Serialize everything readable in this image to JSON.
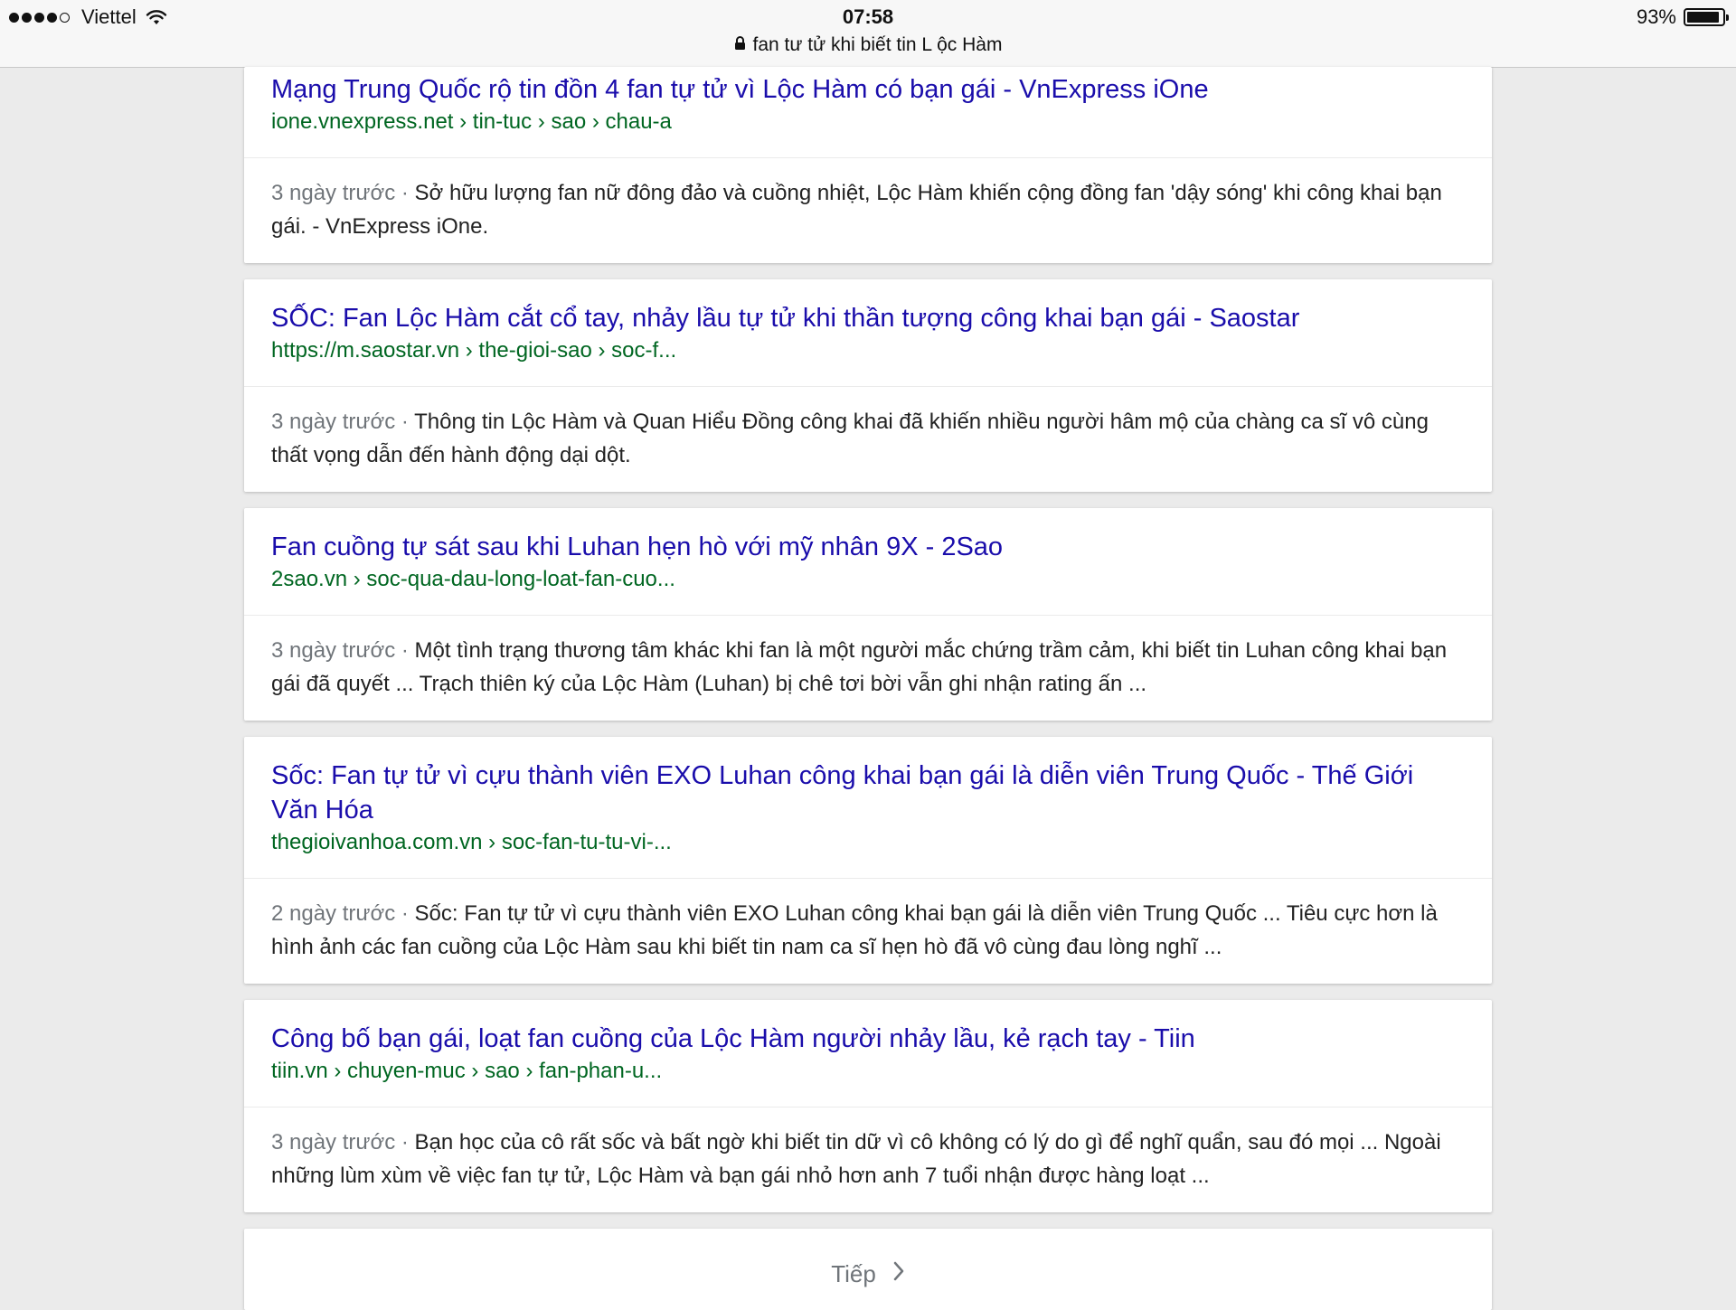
{
  "status_bar": {
    "carrier": "Viettel",
    "time": "07:58",
    "url": "fan tư tử khi biết tin L ộc Hàm",
    "battery": "93%",
    "battery_level": 0.93
  },
  "results": [
    {
      "title": "Mạng Trung Quốc rộ tin đồn 4 fan tự tử vì Lộc Hàm có bạn gái - VnExpress iOne",
      "url": "ione.vnexpress.net › tin-tuc › sao › chau-a",
      "date": "3 ngày trước",
      "snippet": "Sở hữu lượng fan nữ đông đảo và cuồng nhiệt, Lộc Hàm khiến cộng đồng fan 'dậy sóng' khi công khai bạn gái. - VnExpress iOne."
    },
    {
      "title": "SỐC: Fan Lộc Hàm cắt cổ tay, nhảy lầu tự tử khi thần tượng công khai bạn gái - Saostar",
      "url": "https://m.saostar.vn › the-gioi-sao › soc-f...",
      "date": "3 ngày trước",
      "snippet": "Thông tin Lộc Hàm và Quan Hiểu Đồng công khai đã khiến nhiều người hâm mộ của chàng ca sĩ vô cùng thất vọng dẫn đến hành động dại dột."
    },
    {
      "title": "Fan cuồng tự sát sau khi Luhan hẹn hò với mỹ nhân 9X - 2Sao",
      "url": "2sao.vn › soc-qua-dau-long-loat-fan-cuo...",
      "date": "3 ngày trước",
      "snippet": "Một tình trạng thương tâm khác khi fan là một người mắc chứng trầm cảm, khi biết tin Luhan công khai bạn gái đã quyết ... Trạch thiên ký của Lộc Hàm (Luhan) bị chê tơi bời vẫn ghi nhận rating ấn ..."
    },
    {
      "title": "Sốc: Fan tự tử vì cựu thành viên EXO Luhan công khai bạn gái là diễn viên Trung Quốc - Thế Giới Văn Hóa",
      "url": "thegioivanhoa.com.vn › soc-fan-tu-tu-vi-...",
      "date": "2 ngày trước",
      "snippet": "Sốc: Fan tự tử vì cựu thành viên EXO Luhan công khai bạn gái là diễn viên Trung Quốc ... Tiêu cực hơn là hình ảnh các fan cuồng của Lộc Hàm sau khi biết tin nam ca sĩ hẹn hò đã vô cùng đau lòng nghĩ ..."
    },
    {
      "title": "Công bố bạn gái, loạt fan cuồng của Lộc Hàm người nhảy lầu, kẻ rạch tay - Tiin",
      "url": "tiin.vn › chuyen-muc › sao › fan-phan-u...",
      "date": "3 ngày trước",
      "snippet": "Bạn học của cô rất sốc và bất ngờ khi biết tin dữ vì cô không có lý do gì để nghĩ quẩn, sau đó mọi ... Ngoài những lùm xùm về việc fan tự tử, Lộc Hàm và bạn gái nhỏ hơn anh 7 tuổi nhận được hàng loạt ..."
    }
  ],
  "pagination": {
    "next_label": "Tiếp"
  },
  "colors": {
    "title_link": "#1a0dab",
    "url_green": "#006621",
    "date_gray": "#70757a",
    "background": "#ebebeb"
  }
}
